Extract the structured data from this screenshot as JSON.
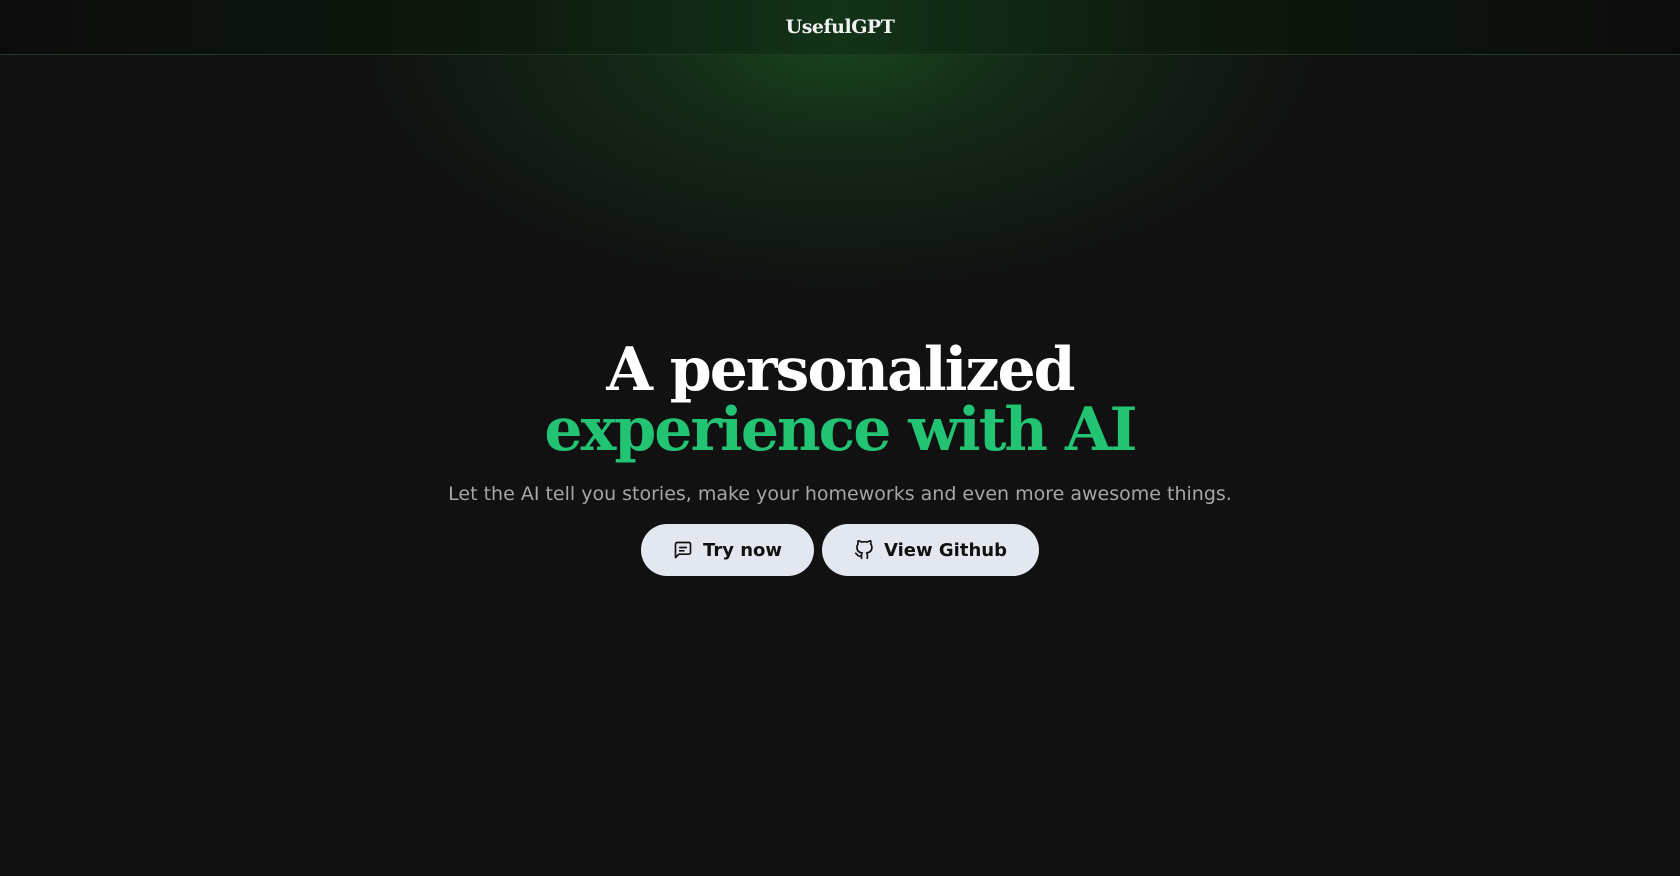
{
  "header": {
    "brand": "UsefulGPT"
  },
  "hero": {
    "headline_line1": "A personalized",
    "headline_line2": "experience with AI",
    "subtitle": "Let the AI tell you stories, make your homeworks and even more awesome things."
  },
  "actions": {
    "try_now_label": "Try now",
    "try_now_icon": "message-square-icon",
    "github_label": "View Github",
    "github_icon": "github-icon"
  },
  "colors": {
    "background": "#111111",
    "accent_green": "#22c373",
    "button_bg": "#e3e8f0",
    "headline_white": "#ffffff",
    "subtitle_gray": "#a6a6a6"
  }
}
